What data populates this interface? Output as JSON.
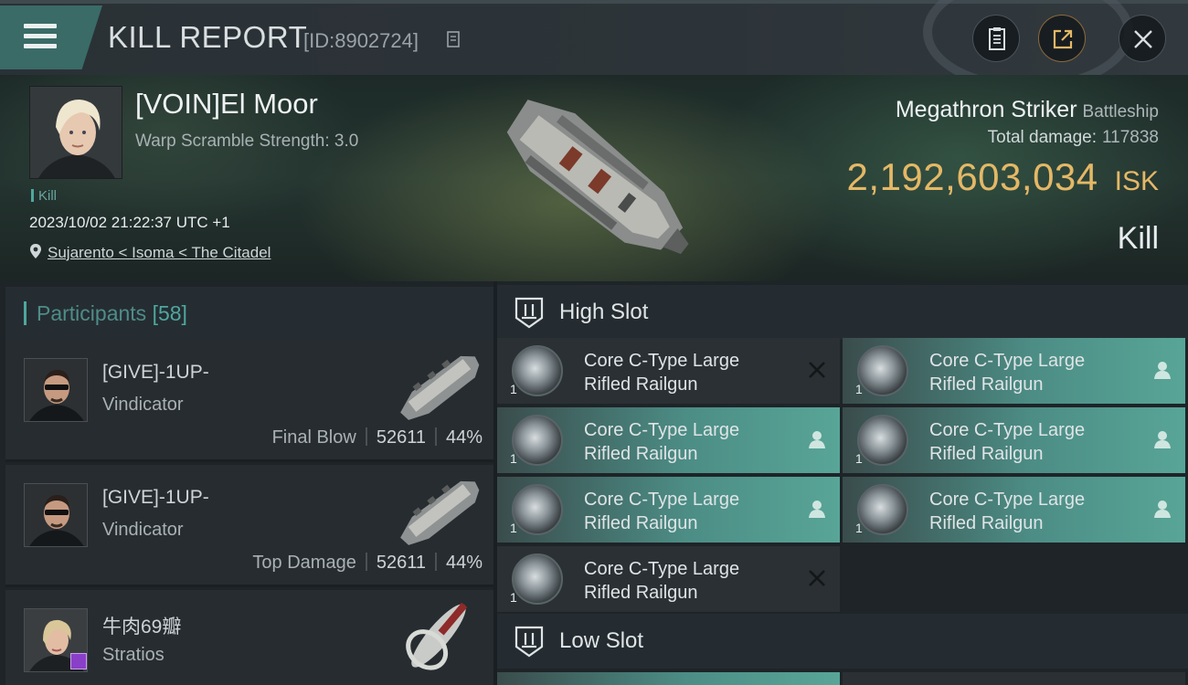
{
  "header": {
    "title": "KILL REPORT",
    "id_text": "[ID:8902724]",
    "icons": {
      "menu": "menu-icon",
      "copy": "copy-icon",
      "report": "clipboard-icon",
      "share": "share-icon",
      "close": "close-icon"
    }
  },
  "victim": {
    "name": "[VOIN]El Moor",
    "warp_scramble": "Warp Scramble Strength: 3.0",
    "tag": "Kill",
    "datetime": "2023/10/02 21:22:37 UTC +1",
    "location": "Sujarento < Isoma < The Citadel",
    "ship_name": "Megathron Striker",
    "ship_class": "Battleship",
    "total_damage_label": "Total damage:",
    "total_damage_value": "117838",
    "isk_value": "2,192,603,034",
    "isk_unit": "ISK",
    "result": "Kill"
  },
  "participants": {
    "label": "Participants",
    "count": "[58]",
    "rows": [
      {
        "name": "[GIVE]-1UP-",
        "ship": "Vindicator",
        "role": "Final Blow",
        "damage": "52611",
        "percent": "44%"
      },
      {
        "name": "[GIVE]-1UP-",
        "ship": "Vindicator",
        "role": "Top Damage",
        "damage": "52611",
        "percent": "44%"
      },
      {
        "name": "牛肉69瓣",
        "ship": "Stratios"
      }
    ]
  },
  "fitting": {
    "high_slot_label": "High Slot",
    "low_slot_label": "Low Slot",
    "modules": [
      {
        "line1": "Core C-Type Large",
        "line2": "Rifled Railgun",
        "qty": "1",
        "state": "destroyed"
      },
      {
        "line1": "Core C-Type Large",
        "line2": "Rifled Railgun",
        "qty": "1",
        "state": "dropped"
      },
      {
        "line1": "Core C-Type Large",
        "line2": "Rifled Railgun",
        "qty": "1",
        "state": "dropped"
      },
      {
        "line1": "Core C-Type Large",
        "line2": "Rifled Railgun",
        "qty": "1",
        "state": "dropped"
      },
      {
        "line1": "Core C-Type Large",
        "line2": "Rifled Railgun",
        "qty": "1",
        "state": "dropped"
      },
      {
        "line1": "Core C-Type Large",
        "line2": "Rifled Railgun",
        "qty": "1",
        "state": "dropped"
      },
      {
        "line1": "Core C-Type Large",
        "line2": "Rifled Railgun",
        "qty": "1",
        "state": "destroyed"
      }
    ]
  },
  "colors": {
    "accent_teal": "#4fa79e",
    "isk_gold": "#e4b866",
    "header_tab": "#3a6b66"
  }
}
